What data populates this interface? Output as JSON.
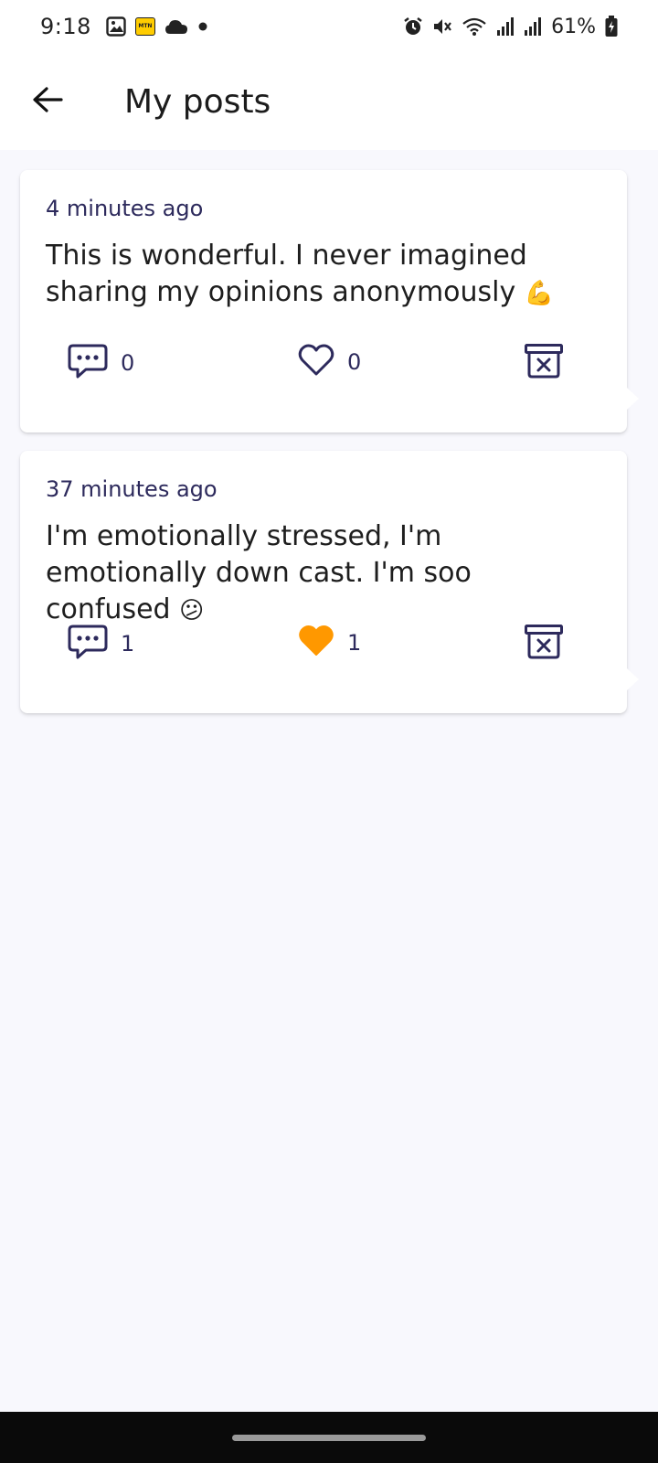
{
  "status_bar": {
    "time": "9:18",
    "battery": "61%",
    "icons": [
      "gallery-icon",
      "mtn-icon",
      "cloud-icon",
      "dot-icon",
      "alarm-icon",
      "mute-icon",
      "wifi-icon",
      "signal-icon",
      "signal-icon",
      "battery-icon"
    ]
  },
  "header": {
    "title": "My posts",
    "back_icon": "arrow-left-icon"
  },
  "colors": {
    "accent": "#2d2a5c",
    "liked": "#ff9800",
    "background": "#f8f8fd"
  },
  "posts": [
    {
      "time": "4 minutes ago",
      "text": "This is wonderful. I never imagined sharing my opinions anonymously",
      "emoji": "💪",
      "comments": "0",
      "likes": "0",
      "liked": false
    },
    {
      "time": "37 minutes ago",
      "text": "I'm emotionally stressed, I'm emotionally down cast. I'm soo confused",
      "emoji": "😕",
      "comments": "1",
      "likes": "1",
      "liked": true
    }
  ]
}
